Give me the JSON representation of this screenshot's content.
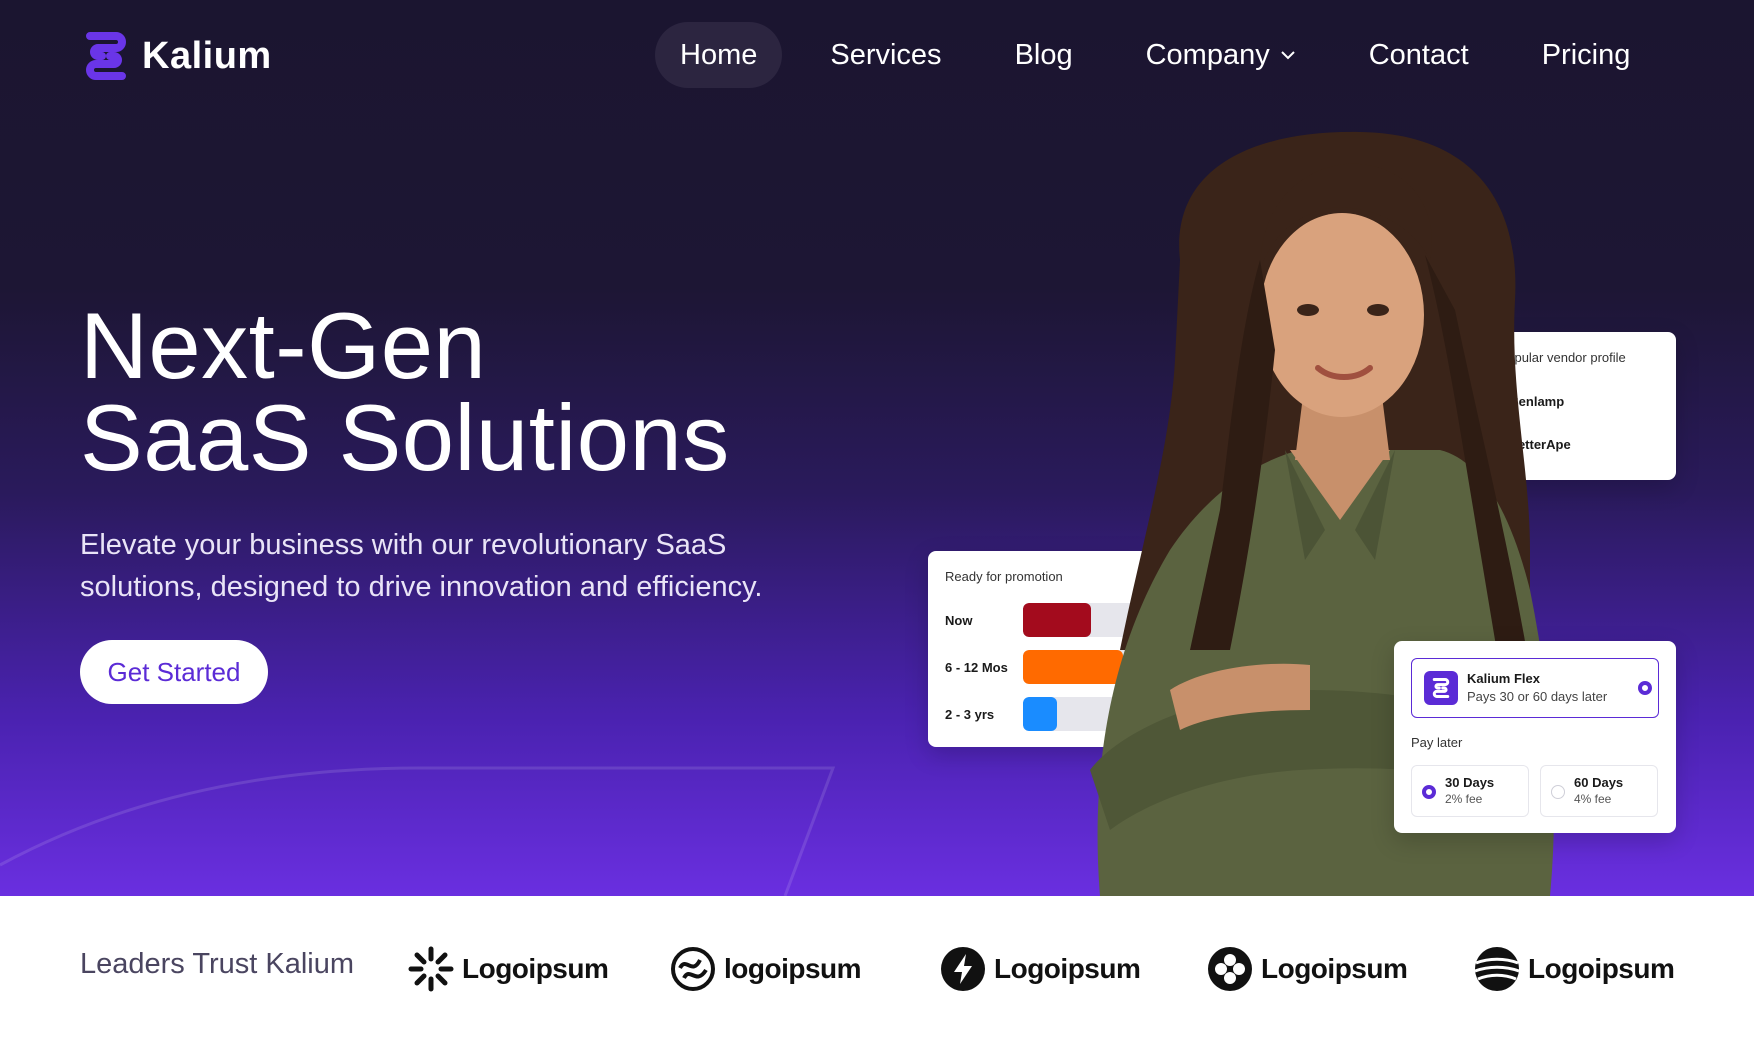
{
  "brand": {
    "name": "Kalium",
    "accent": "#5b2bd6"
  },
  "nav": {
    "items": [
      {
        "label": "Home",
        "active": true
      },
      {
        "label": "Services"
      },
      {
        "label": "Blog"
      },
      {
        "label": "Company",
        "dropdown": true
      },
      {
        "label": "Contact"
      },
      {
        "label": "Pricing"
      }
    ]
  },
  "hero": {
    "title_line1": "Next-Gen",
    "title_line2": "SaaS Solutions",
    "subtitle": "Elevate your business with our revolutionary SaaS solutions, designed to drive innovation and efficiency.",
    "cta": "Get Started"
  },
  "vendor_card": {
    "title": "popular vendor profile",
    "items": [
      "Senlamp",
      "LetterApe"
    ]
  },
  "promo_card": {
    "title": "Ready for promotion",
    "rows": [
      {
        "label": "Now",
        "color": "#a30b1d"
      },
      {
        "label": "6 - 12 Mos",
        "color": "#ff6a00"
      },
      {
        "label": "2 - 3 yrs",
        "color": "#1a8cff"
      }
    ]
  },
  "flex_card": {
    "name": "Kalium Flex",
    "desc": "Pays 30 or 60 days later",
    "pay_later": "Pay later",
    "options": [
      {
        "title": "30 Days",
        "sub": "2% fee",
        "selected": true
      },
      {
        "title": "60 Days",
        "sub": "4% fee",
        "selected": false
      }
    ]
  },
  "trust": {
    "label": "Leaders Trust Kalium",
    "logos": [
      {
        "text": "Logoipsum",
        "icon": "sunburst-icon"
      },
      {
        "text": "logoipsum",
        "icon": "wave-circle-icon"
      },
      {
        "text": "Logoipsum",
        "icon": "bolt-circle-icon"
      },
      {
        "text": "Logoipsum",
        "icon": "clover-circle-icon"
      },
      {
        "text": "Logoipsum",
        "icon": "globe-stripes-icon"
      }
    ]
  }
}
